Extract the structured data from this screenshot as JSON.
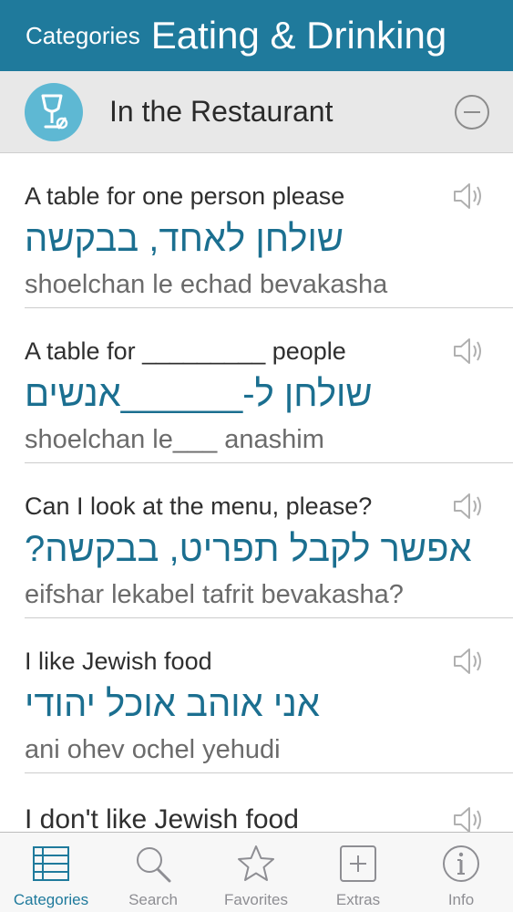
{
  "header": {
    "back_label": "Categories",
    "title": "Eating & Drinking"
  },
  "section": {
    "title": "In the Restaurant",
    "icon": "wine-glass-fork-icon"
  },
  "phrases": [
    {
      "english": "A table for one person please",
      "hebrew": "שולחן לאחד, בבקשה",
      "translit": "shoelchan le echad bevakasha"
    },
    {
      "english": "A table for _________ people",
      "hebrew": "שולחן ל-______אנשים",
      "translit": "shoelchan le___ anashim"
    },
    {
      "english": "Can I look at the menu, please?",
      "hebrew": "אפשר לקבל תפריט, בבקשה?",
      "translit": "eifshar lekabel tafrit bevakasha?"
    },
    {
      "english": "I like Jewish food",
      "hebrew": "אני אוהב אוכל יהודי",
      "translit": "ani ohev ochel yehudi"
    },
    {
      "english": "I don't like Jewish food",
      "hebrew": "",
      "translit": ""
    }
  ],
  "tabs": [
    {
      "label": "Categories",
      "icon": "list-icon",
      "active": true
    },
    {
      "label": "Search",
      "icon": "search-icon",
      "active": false
    },
    {
      "label": "Favorites",
      "icon": "star-icon",
      "active": false
    },
    {
      "label": "Extras",
      "icon": "plus-square-icon",
      "active": false
    },
    {
      "label": "Info",
      "icon": "info-icon",
      "active": false
    }
  ],
  "colors": {
    "header_bg": "#1f7a9c",
    "hebrew_text": "#1b6f90",
    "active_tab": "#1f7a9c",
    "inactive_tab": "#8e8e93"
  }
}
